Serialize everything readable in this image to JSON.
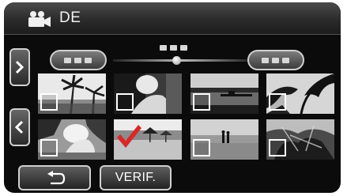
{
  "header": {
    "mode_icon": "movie-camera-icon",
    "title": "DE"
  },
  "date_pills": [
    {
      "name": "previous-date",
      "dots": 3
    },
    {
      "name": "next-date",
      "dots": 3
    }
  ],
  "slider": {
    "position": 0.45
  },
  "nav": {
    "next_icon": "chevron-right-icon",
    "prev_icon": "chevron-left-icon"
  },
  "thumbnails": [
    {
      "scene": "palm-trees-beach",
      "checked": false
    },
    {
      "scene": "person-portrait",
      "checked": false
    },
    {
      "scene": "pier-sunset",
      "checked": false
    },
    {
      "scene": "palm-leaves-sky",
      "checked": false
    },
    {
      "scene": "people-beach-play",
      "checked": false
    },
    {
      "scene": "beach-umbrellas",
      "checked": true
    },
    {
      "scene": "couple-shore",
      "checked": false
    },
    {
      "scene": "tropical-plants",
      "checked": false
    }
  ],
  "buttons": {
    "back_icon": "return-arrow-icon",
    "verif_label": "VERIF."
  },
  "colors": {
    "checkmark": "#d8282a",
    "accent_border": "#d0d0d0"
  }
}
